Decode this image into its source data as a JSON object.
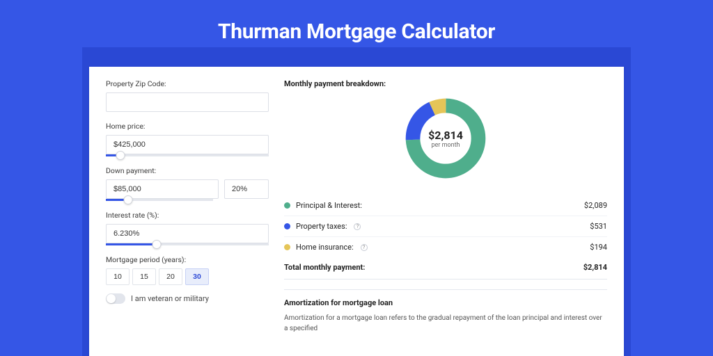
{
  "page_title": "Thurman Mortgage Calculator",
  "fields": {
    "zip_label": "Property Zip Code:",
    "zip_value": "",
    "home_label": "Home price:",
    "home_value": "$425,000",
    "home_slider_percent": 9,
    "down_label": "Down payment:",
    "down_amount": "$85,000",
    "down_percent": "20%",
    "down_slider_percent": 21,
    "rate_label": "Interest rate (%):",
    "rate_value": "6.230%",
    "rate_slider_percent": 31,
    "period_label": "Mortgage period (years):",
    "period_options": [
      "10",
      "15",
      "20",
      "30"
    ],
    "period_selected": "30",
    "veteran_label": "I am veteran or military",
    "veteran_on": false
  },
  "breakdown": {
    "heading": "Monthly payment breakdown:",
    "center_value": "$2,814",
    "center_sub": "per month",
    "items": [
      {
        "label": "Principal & Interest:",
        "value": "$2,089",
        "color": "green",
        "info": false
      },
      {
        "label": "Property taxes:",
        "value": "$531",
        "color": "blue",
        "info": true
      },
      {
        "label": "Home insurance:",
        "value": "$194",
        "color": "gold",
        "info": true
      }
    ],
    "total_label": "Total monthly payment:",
    "total_value": "$2,814"
  },
  "amortization": {
    "heading": "Amortization for mortgage loan",
    "body": "Amortization for a mortgage loan refers to the gradual repayment of the loan principal and interest over a specified"
  },
  "chart_data": {
    "type": "pie",
    "title": "Monthly payment breakdown",
    "series": [
      {
        "name": "Principal & Interest",
        "value": 2089,
        "color": "#4fae8c"
      },
      {
        "name": "Property taxes",
        "value": 531,
        "color": "#3556e6"
      },
      {
        "name": "Home insurance",
        "value": 194,
        "color": "#e5c558"
      }
    ],
    "total": 2814,
    "center_label": "$2,814 per month"
  }
}
